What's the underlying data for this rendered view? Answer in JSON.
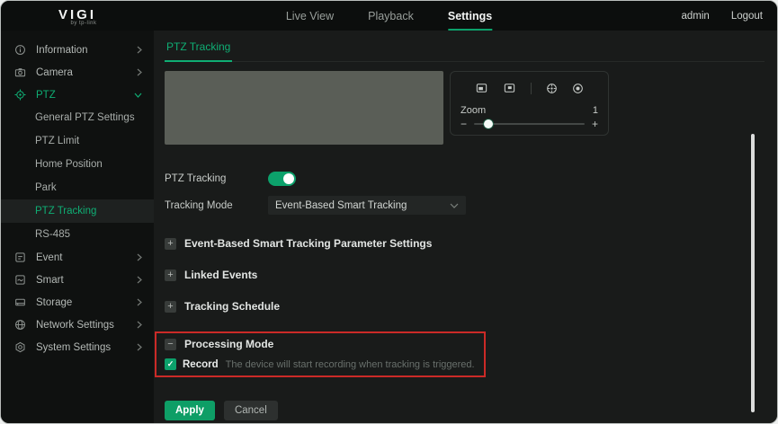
{
  "brand": {
    "logo": "VIGI",
    "tagline": "by tp-link"
  },
  "topnav": {
    "items": [
      {
        "label": "Live View",
        "active": false
      },
      {
        "label": "Playback",
        "active": false
      },
      {
        "label": "Settings",
        "active": true
      }
    ],
    "user": "admin",
    "logout": "Logout"
  },
  "sidebar": {
    "items": [
      {
        "label": "Information",
        "icon": "info-icon",
        "expanded": false
      },
      {
        "label": "Camera",
        "icon": "camera-icon",
        "expanded": false
      },
      {
        "label": "PTZ",
        "icon": "ptz-icon",
        "expanded": true,
        "active": true
      },
      {
        "label": "Event",
        "icon": "event-icon",
        "expanded": false
      },
      {
        "label": "Smart",
        "icon": "smart-icon",
        "expanded": false
      },
      {
        "label": "Storage",
        "icon": "storage-icon",
        "expanded": false
      },
      {
        "label": "Network Settings",
        "icon": "network-icon",
        "expanded": false
      },
      {
        "label": "System Settings",
        "icon": "system-icon",
        "expanded": false
      }
    ],
    "ptz_children": [
      "General PTZ Settings",
      "PTZ Limit",
      "Home Position",
      "Park",
      "PTZ Tracking",
      "RS-485"
    ],
    "selected_child": "PTZ Tracking"
  },
  "main": {
    "tab": "PTZ Tracking",
    "controls": {
      "icons": [
        "focus-near",
        "focus-far",
        "iris-open",
        "iris-close"
      ],
      "zoom_label": "Zoom",
      "zoom_value": "1",
      "minus": "−",
      "plus": "+"
    },
    "form": {
      "ptz_tracking_label": "PTZ Tracking",
      "ptz_tracking_enabled": true,
      "tracking_mode_label": "Tracking Mode",
      "tracking_mode_value": "Event-Based Smart Tracking"
    },
    "sections": [
      {
        "title": "Event-Based Smart Tracking Parameter Settings",
        "expanded": false
      },
      {
        "title": "Linked Events",
        "expanded": false
      },
      {
        "title": "Tracking Schedule",
        "expanded": false
      },
      {
        "title": "Processing Mode",
        "expanded": true
      }
    ],
    "record": {
      "label": "Record",
      "checked": true,
      "check_glyph": "✓",
      "hint": "The device will start recording when tracking is triggered."
    },
    "buttons": {
      "apply": "Apply",
      "cancel": "Cancel"
    }
  },
  "icons": {
    "expand": "+",
    "collapse": "−"
  },
  "colors": {
    "accent": "#0fae74",
    "toggle_on": "#0ca16b",
    "annotation": "#cb2a27",
    "apply": "#0e9e66"
  }
}
